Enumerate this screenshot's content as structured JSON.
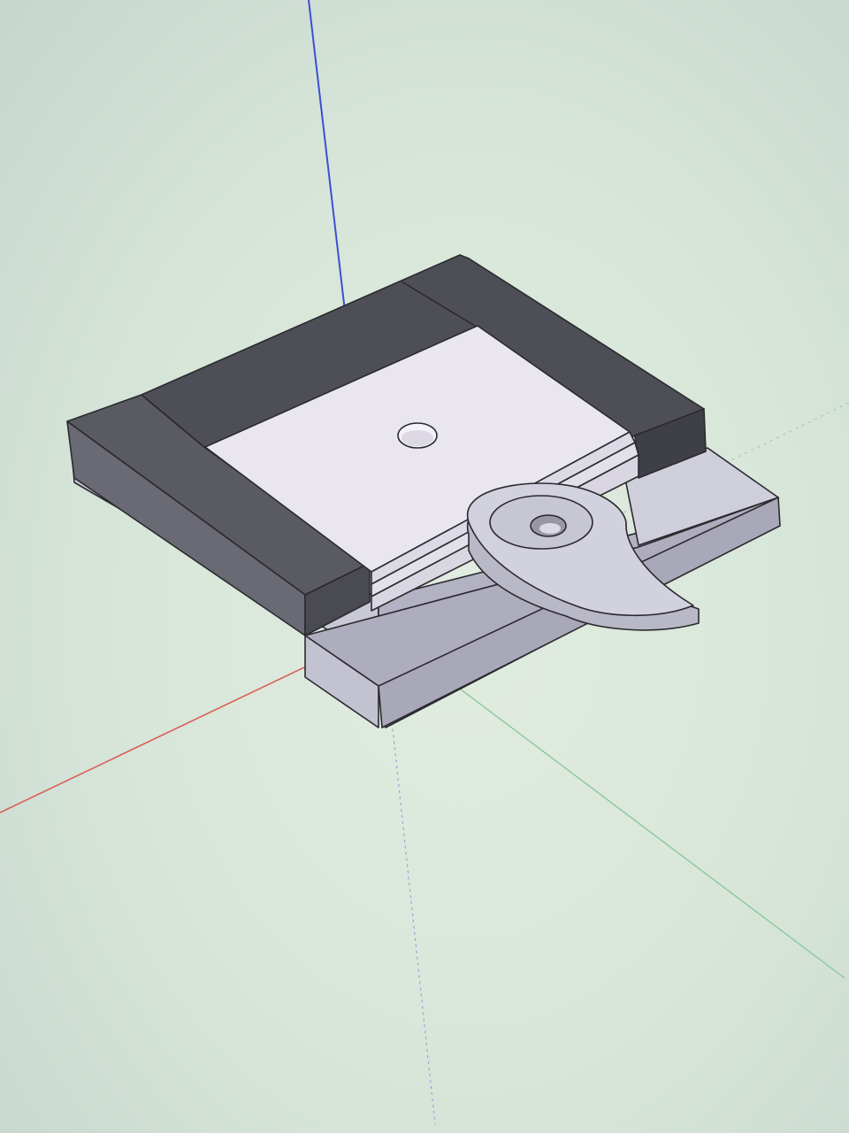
{
  "viewport": {
    "background": "#d6e4d8",
    "axes": {
      "red_axis_color": "#d9605a",
      "green_axis_color": "#8ec79a",
      "blue_axis_color": "#3b4fd6"
    }
  },
  "model": {
    "components": [
      {
        "name": "base-plate",
        "color": "#b9b8c8"
      },
      {
        "name": "side-rail-left",
        "color": "#55555d"
      },
      {
        "name": "side-rail-back",
        "color": "#4a4a52"
      },
      {
        "name": "center-plate",
        "color": "#e6e3ee",
        "hole": true
      },
      {
        "name": "cam-lever",
        "color": "#c9c8d4",
        "hole": true
      }
    ]
  }
}
